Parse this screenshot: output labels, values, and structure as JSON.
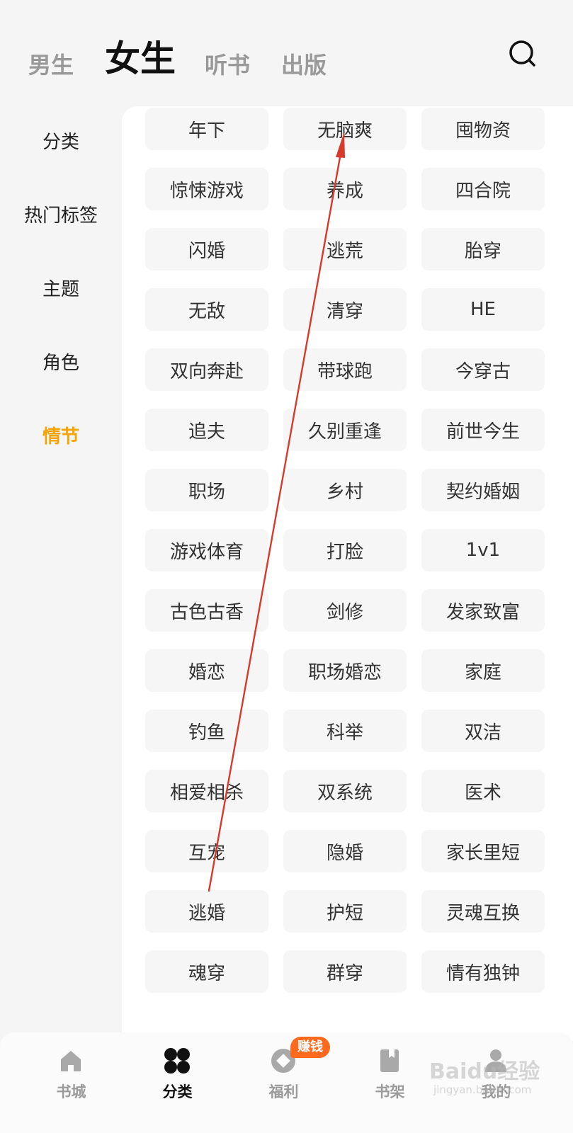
{
  "header": {
    "tabs": [
      {
        "label": "男生"
      },
      {
        "label": "女生"
      },
      {
        "label": "听书"
      },
      {
        "label": "出版"
      }
    ]
  },
  "sidebar": {
    "items": [
      {
        "label": "分类"
      },
      {
        "label": "热门标签"
      },
      {
        "label": "主题"
      },
      {
        "label": "角色"
      },
      {
        "label": "情节"
      }
    ]
  },
  "tags": [
    "年下",
    "无脑爽",
    "囤物资",
    "惊悚游戏",
    "养成",
    "四合院",
    "闪婚",
    "逃荒",
    "胎穿",
    "无敌",
    "清穿",
    "HE",
    "双向奔赴",
    "带球跑",
    "今穿古",
    "追夫",
    "久别重逢",
    "前世今生",
    "职场",
    "乡村",
    "契约婚姻",
    "游戏体育",
    "打脸",
    "1v1",
    "古色古香",
    "剑修",
    "发家致富",
    "婚恋",
    "职场婚恋",
    "家庭",
    "钓鱼",
    "科举",
    "双洁",
    "相爱相杀",
    "双系统",
    "医术",
    "互宠",
    "隐婚",
    "家长里短",
    "逃婚",
    "护短",
    "灵魂互换",
    "魂穿",
    "群穿",
    "情有独钟"
  ],
  "bottom_nav": {
    "items": [
      {
        "label": "书城"
      },
      {
        "label": "分类"
      },
      {
        "label": "福利"
      },
      {
        "label": "书架"
      },
      {
        "label": "我的"
      }
    ],
    "badge": "赚钱"
  },
  "watermark": {
    "brand": "Baidu经验",
    "url": "jingyan.baidu.com"
  },
  "colors": {
    "accent": "#f6a405",
    "badge": "#ff6a1f",
    "annotation": "#d63a2b"
  }
}
